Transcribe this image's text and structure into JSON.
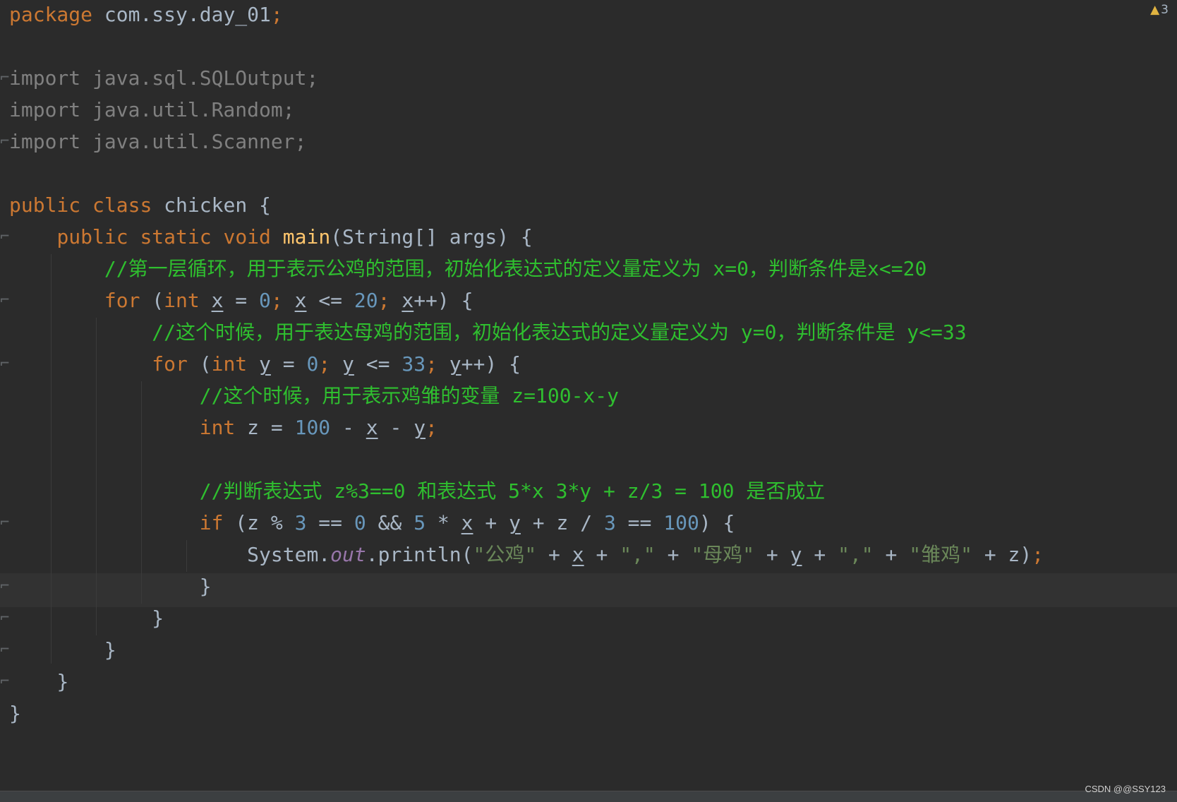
{
  "editor": {
    "warning_count": "3",
    "lines": [
      [
        "package",
        " ",
        "com.ssy.day_01",
        ";"
      ],
      [],
      [
        "import java.sql.SQLOutput;"
      ],
      [
        "import java.util.Random;"
      ],
      [
        "import java.util.Scanner;"
      ],
      [],
      [
        "public",
        " ",
        "class",
        " chicken {"
      ],
      [
        "    ",
        "public",
        " ",
        "static",
        " ",
        "void",
        " ",
        "main",
        "(String[] args) {"
      ],
      [
        "        ",
        "//第一层循环，用于表示公鸡的范围，初始化表达式的定义量定义为 x=0，判断条件是x<=20"
      ],
      [
        "        ",
        "for",
        " (",
        "int",
        " ",
        "x",
        " = ",
        "0",
        "; ",
        "x",
        " <= ",
        "20",
        "; ",
        "x",
        "++) {"
      ],
      [
        "            ",
        "//这个时候，用于表达母鸡的范围，初始化表达式的定义量定义为 y=0，判断条件是 y<=33"
      ],
      [
        "            ",
        "for",
        " (",
        "int",
        " ",
        "y",
        " = ",
        "0",
        "; ",
        "y",
        " <= ",
        "33",
        "; ",
        "y",
        "++) {"
      ],
      [
        "                ",
        "//这个时候，用于表示鸡雏的变量 z=100-x-y"
      ],
      [
        "                ",
        "int",
        " z = ",
        "100",
        " - ",
        "x",
        " - ",
        "y",
        ";"
      ],
      [],
      [
        "                ",
        "//判断表达式 z%3==0 和表达式 5*x 3*y + z/3 = 100 是否成立"
      ],
      [
        "                ",
        "if",
        " (z % ",
        "3",
        " == ",
        "0",
        " && ",
        "5",
        " * ",
        "x",
        " + ",
        "y",
        " + z / ",
        "3",
        " == ",
        "100",
        ") {"
      ],
      [
        "                    ",
        "System.",
        "out",
        ".println(",
        "\"公鸡\"",
        " + ",
        "x",
        " + ",
        "\",\"",
        " + ",
        "\"母鸡\"",
        " + ",
        "y",
        " + ",
        "\",\"",
        " + ",
        "\"雏鸡\"",
        " + z)",
        ";"
      ],
      [
        "                ",
        "}"
      ],
      [
        "            ",
        "}"
      ],
      [
        "        ",
        "}"
      ],
      [
        "    ",
        "}"
      ],
      [
        "}"
      ]
    ]
  },
  "watermark": "CSDN @@SSY123",
  "colors": {
    "background": "#2b2b2b",
    "keyword": "#cc7832",
    "number": "#6897bb",
    "string": "#6a8759",
    "comment": "#2fbf2f",
    "method": "#ffc66d",
    "field": "#9876aa",
    "text": "#a9b7c6"
  }
}
